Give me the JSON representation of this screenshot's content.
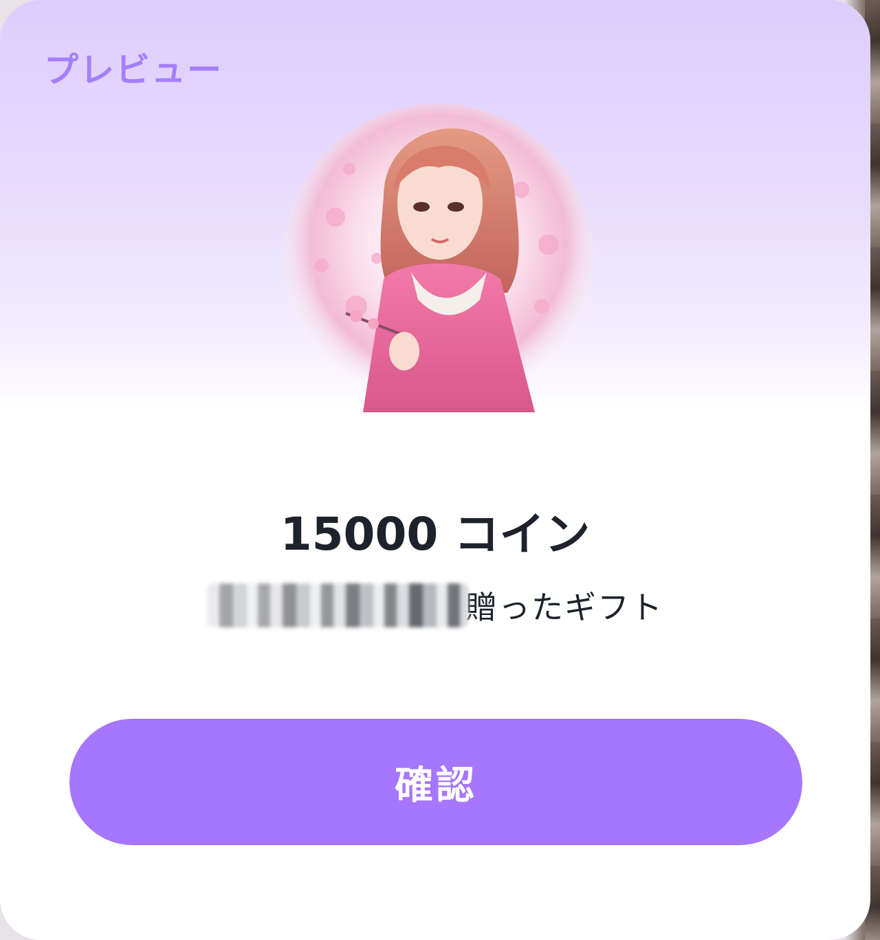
{
  "dialog": {
    "title": "プレビュー",
    "gift_image": "anime-girl-cherry-blossom-illustration",
    "amount_text": "15000 コイン",
    "subtitle_suffix": "贈ったギフト",
    "confirm_label": "確認"
  },
  "colors": {
    "accent": "#a676fe",
    "title": "#a57efc",
    "text": "#1d222c",
    "header_gradient_top": "#ddcdfd"
  }
}
